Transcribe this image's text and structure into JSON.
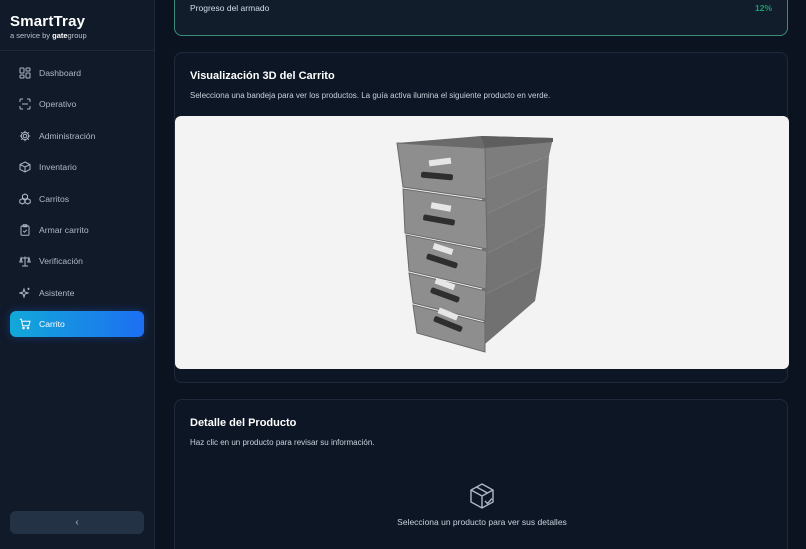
{
  "brand": {
    "name": "SmartTray",
    "sub_prefix": "a service by ",
    "sub_company_bold": "gate",
    "sub_company_rest": "group"
  },
  "sidebar": {
    "items": [
      {
        "label": "Dashboard",
        "icon": "dashboard-icon"
      },
      {
        "label": "Operativo",
        "icon": "scan-icon"
      },
      {
        "label": "Administración",
        "icon": "gear-icon"
      },
      {
        "label": "Inventario",
        "icon": "box-icon"
      },
      {
        "label": "Carritos",
        "icon": "boxes-icon"
      },
      {
        "label": "Armar carrito",
        "icon": "clipboard-icon"
      },
      {
        "label": "Verificación",
        "icon": "scale-icon"
      },
      {
        "label": "Asistente",
        "icon": "sparkle-icon"
      },
      {
        "label": "Carrito",
        "icon": "cart-icon",
        "active": true
      }
    ],
    "collapse_label": "‹"
  },
  "progress": {
    "label": "Progreso del armado",
    "value_text": "12%"
  },
  "visualization": {
    "title": "Visualización 3D del Carrito",
    "description": "Selecciona una bandeja para ver los productos. La guía activa ilumina el siguiente producto en verde."
  },
  "detail": {
    "title": "Detalle del Producto",
    "description": "Haz clic en un producto para revisar su información.",
    "empty_text": "Selecciona un producto para ver sus detalles"
  },
  "colors": {
    "accent_start": "#12a8d8",
    "accent_end": "#1d6ff2",
    "progress_border": "#3b8c78",
    "progress_value": "#1f9e6a"
  }
}
